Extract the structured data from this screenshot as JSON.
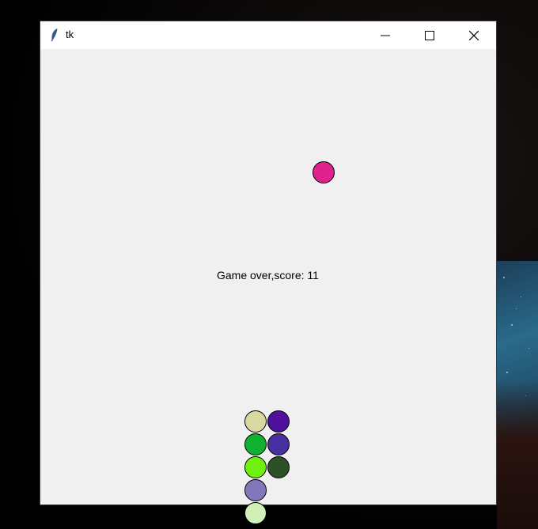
{
  "window": {
    "title": "tk",
    "icon": "feather-icon",
    "controls": [
      "minimize-icon",
      "maximize-icon",
      "close-icon"
    ]
  },
  "game": {
    "message": "Game over,score: 11",
    "score": 11,
    "falling_ball_color": "#e0208c",
    "stacked_ball_colors": {
      "column_1": [
        "#d8d8a0",
        "#10b030",
        "#70f010",
        "#8078b8",
        "#d0f0b8"
      ],
      "column_2": [
        "#50109c",
        "#4830a0",
        "#2d5028"
      ]
    }
  }
}
